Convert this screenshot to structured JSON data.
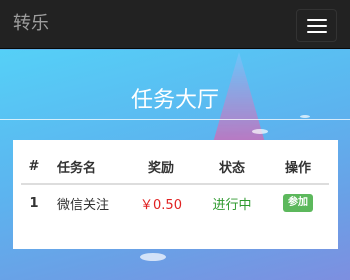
{
  "navbar": {
    "brand": "转乐",
    "toggle_icon": "hamburger-icon"
  },
  "hero": {
    "title": "任务大厅"
  },
  "table": {
    "headers": {
      "index": "#",
      "name": "任务名",
      "reward": "奖励",
      "status": "状态",
      "action": "操作"
    },
    "rows": [
      {
        "index": "1",
        "name": "微信关注",
        "reward": "￥0.50",
        "status": "进行中",
        "action": "参加"
      }
    ]
  },
  "colors": {
    "navbar": "#222222",
    "reward": "#e02222",
    "status": "#2f9a2f",
    "button": "#5cb85c"
  }
}
